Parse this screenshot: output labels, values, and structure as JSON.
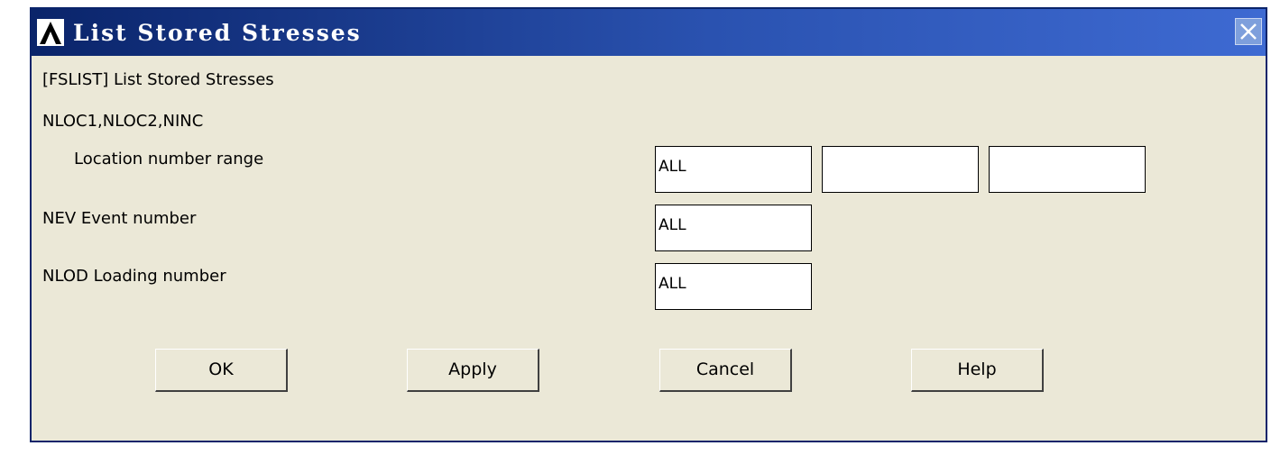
{
  "window": {
    "title": "List Stored Stresses",
    "logo_icon": "ansys-logo-icon",
    "close_icon": "close-icon"
  },
  "dialog": {
    "command_label": "[FSLIST] List Stored Stresses",
    "params_label": "NLOC1,NLOC2,NINC",
    "location_label": "Location number range",
    "nev_label": "NEV  Event number",
    "nlod_label": "NLOD  Loading number"
  },
  "fields": {
    "nloc1": "ALL",
    "nloc2": "",
    "ninc": "",
    "nev": "ALL",
    "nlod": "ALL"
  },
  "buttons": {
    "ok": "OK",
    "apply": "Apply",
    "cancel": "Cancel",
    "help": "Help"
  },
  "colors": {
    "titlebar_start": "#0a246a",
    "titlebar_end": "#3e6ad2",
    "dialog_bg": "#ebe8d7"
  }
}
